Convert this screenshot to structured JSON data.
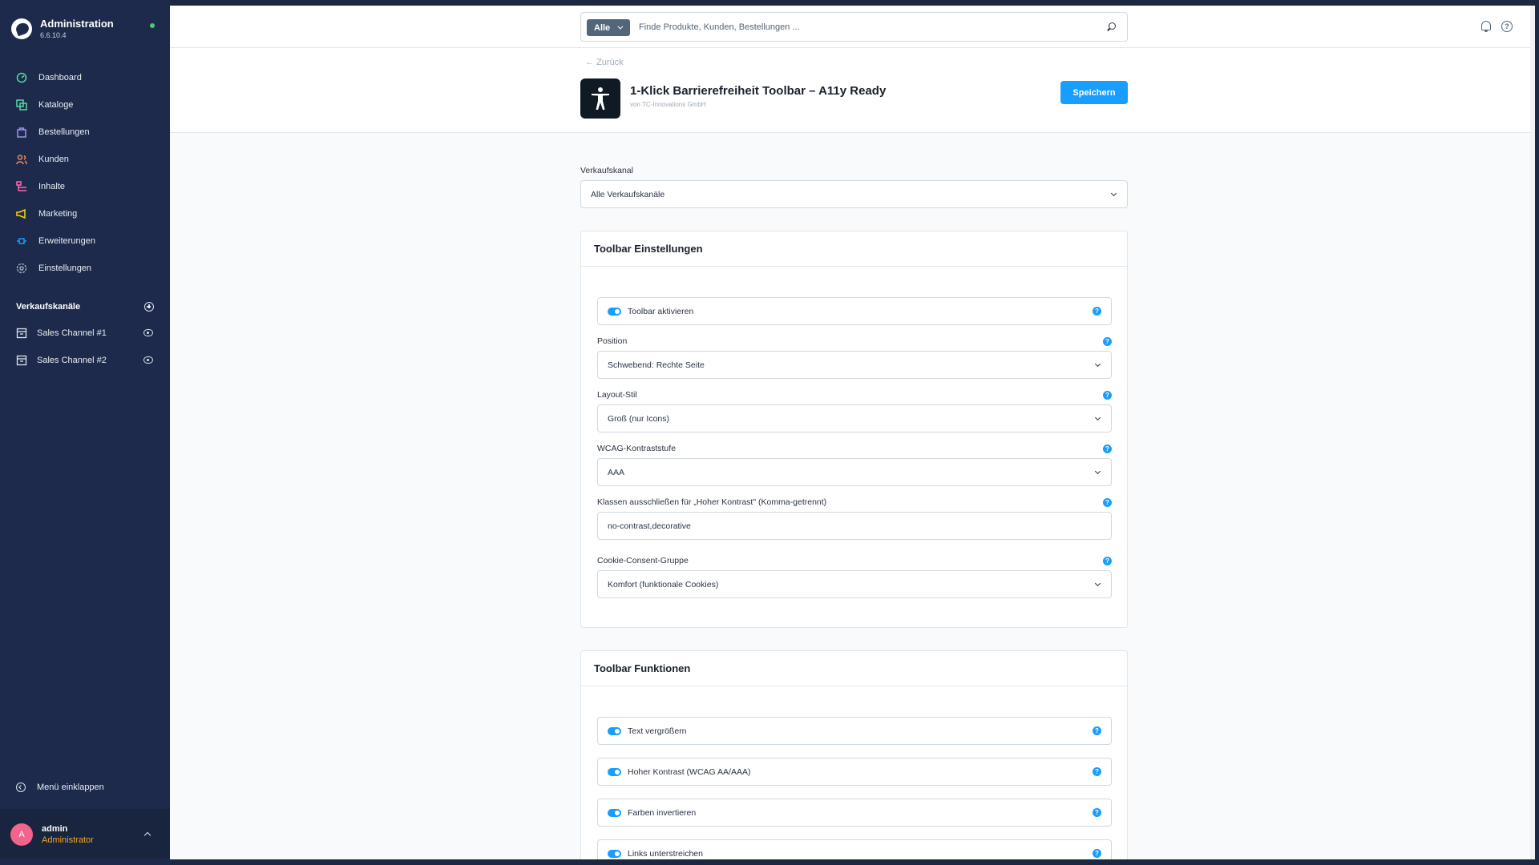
{
  "app": {
    "title": "Administration",
    "version": "6.6.10.4"
  },
  "nav": {
    "items": [
      {
        "label": "Dashboard",
        "icon": "dashboard-icon",
        "color": "#57d9a3"
      },
      {
        "label": "Kataloge",
        "icon": "catalog-icon",
        "color": "#57d9a3"
      },
      {
        "label": "Bestellungen",
        "icon": "orders-icon",
        "color": "#a092f0"
      },
      {
        "label": "Kunden",
        "icon": "customers-icon",
        "color": "#f88962"
      },
      {
        "label": "Inhalte",
        "icon": "content-icon",
        "color": "#ff68b4"
      },
      {
        "label": "Marketing",
        "icon": "marketing-icon",
        "color": "#ffd700"
      },
      {
        "label": "Erweiterungen",
        "icon": "extensions-icon",
        "color": "#189eff"
      },
      {
        "label": "Einstellungen",
        "icon": "settings-icon",
        "color": "#9aa8b5"
      }
    ],
    "channels_heading": "Verkaufskanäle",
    "channels": [
      {
        "label": "Sales Channel #1"
      },
      {
        "label": "Sales Channel #2"
      }
    ],
    "collapse_label": "Menü einklappen"
  },
  "user": {
    "initial": "A",
    "name": "admin",
    "role": "Administrator"
  },
  "search": {
    "type": "Alle",
    "placeholder": "Finde Produkte, Kunden, Bestellungen ..."
  },
  "header": {
    "back": "Zurück",
    "plugin_title": "1-Klick Barrierefreiheit Toolbar – A11y Ready",
    "vendor": "von TC-Innovations GmbH",
    "save_label": "Speichern"
  },
  "sales_channel": {
    "label": "Verkaufskanal",
    "value": "Alle Verkaufskanäle"
  },
  "settings_card": {
    "title": "Toolbar Einstellungen",
    "toggle_label": "Toolbar aktivieren",
    "position_label": "Position",
    "position_value": "Schwebend: Rechte Seite",
    "layout_label": "Layout-Stil",
    "layout_value": "Groß (nur Icons)",
    "wcag_label": "WCAG-Kontraststufe",
    "wcag_value": "AAA",
    "exclude_label": "Klassen ausschließen für „Hoher Kontrast\" (Komma-getrennt)",
    "exclude_value": "no-contrast,decorative",
    "cookie_label": "Cookie-Consent-Gruppe",
    "cookie_value": "Komfort (funktionale Cookies)"
  },
  "functions_card": {
    "title": "Toolbar Funktionen",
    "toggles": [
      {
        "label": "Text vergrößern"
      },
      {
        "label": "Hoher Kontrast (WCAG AA/AAA)"
      },
      {
        "label": "Farben invertieren"
      },
      {
        "label": "Links unterstreichen"
      }
    ]
  },
  "help_glyph": "?"
}
